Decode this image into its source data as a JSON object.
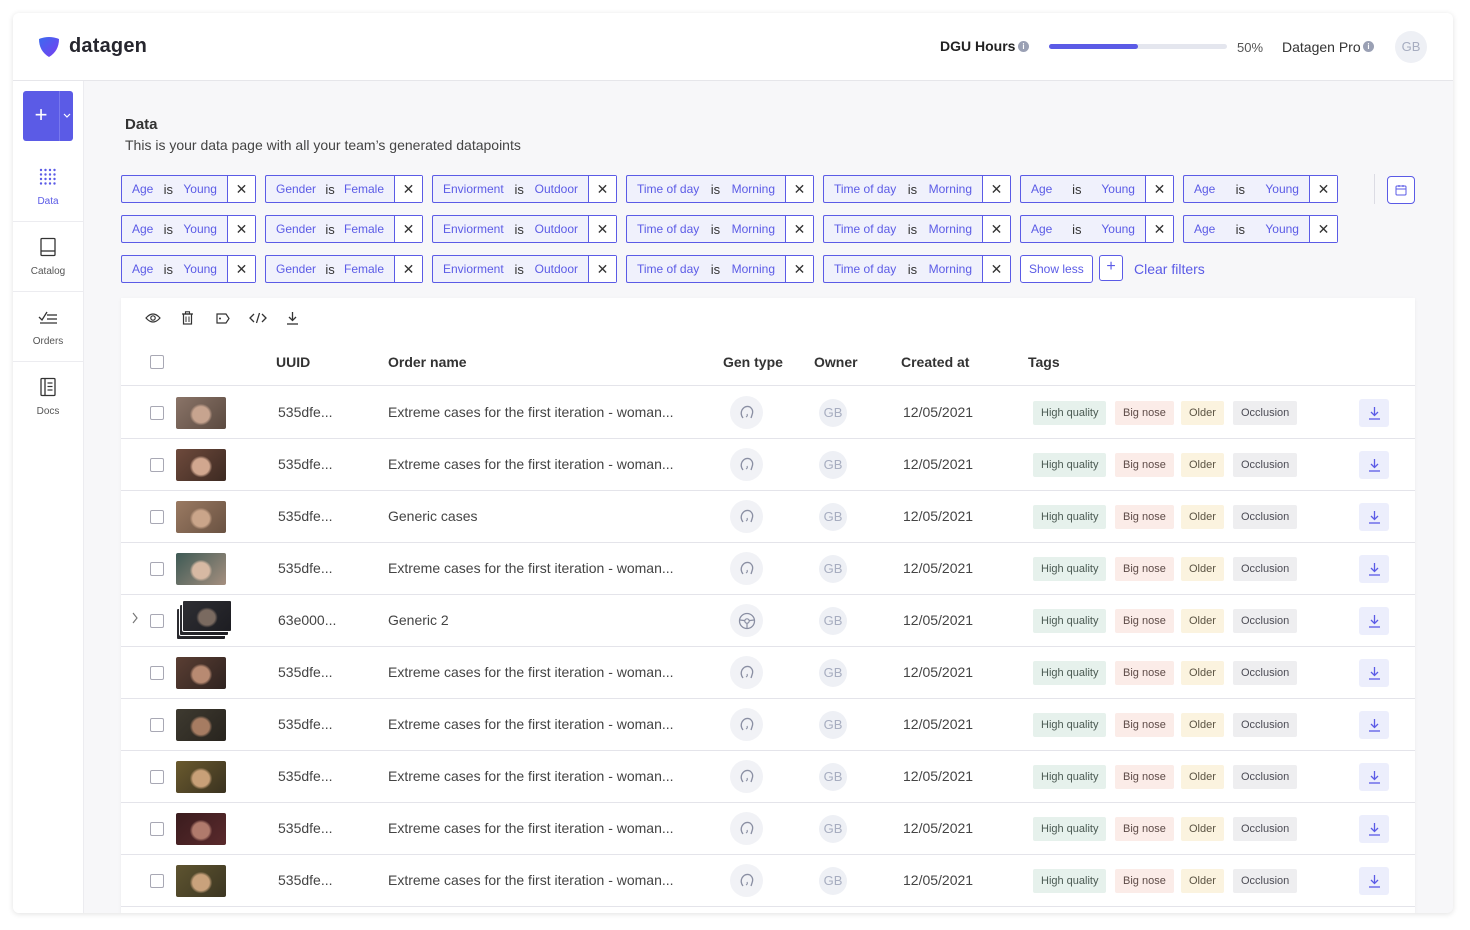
{
  "brand": {
    "name": "datagen",
    "accent": "#5b5be6"
  },
  "topbar": {
    "dgu_label": "DGU Hours",
    "progress_percent": 50,
    "progress_text": "50%",
    "plan_label": "Datagen Pro",
    "avatar": "GB",
    "info_glyph": "i"
  },
  "sidebar": {
    "add_glyph": "+",
    "items": [
      {
        "label": "Data",
        "icon": "grid-dots-icon",
        "active": true
      },
      {
        "label": "Catalog",
        "icon": "book-icon",
        "active": false
      },
      {
        "label": "Orders",
        "icon": "checklist-icon",
        "active": false
      },
      {
        "label": "Docs",
        "icon": "document-icon",
        "active": false
      }
    ]
  },
  "page": {
    "title": "Data",
    "subtitle": "This is your data page with all your team’s generated datapoints"
  },
  "filters": {
    "operator": "is",
    "remove_glyph": "✕",
    "rows": [
      [
        {
          "key": "Age",
          "value": "Young"
        },
        {
          "key": "Gender",
          "value": "Female"
        },
        {
          "key": "Enviorment",
          "value": "Outdoor"
        },
        {
          "key": "Time of day",
          "value": "Morning"
        },
        {
          "key": "Time of day",
          "value": "Morning"
        },
        {
          "key": "Age",
          "value": "Young"
        },
        {
          "key": "Age",
          "value": "Young"
        }
      ],
      [
        {
          "key": "Age",
          "value": "Young"
        },
        {
          "key": "Gender",
          "value": "Female"
        },
        {
          "key": "Enviorment",
          "value": "Outdoor"
        },
        {
          "key": "Time of day",
          "value": "Morning"
        },
        {
          "key": "Time of day",
          "value": "Morning"
        },
        {
          "key": "Age",
          "value": "Young"
        },
        {
          "key": "Age",
          "value": "Young"
        }
      ],
      [
        {
          "key": "Age",
          "value": "Young"
        },
        {
          "key": "Gender",
          "value": "Female"
        },
        {
          "key": "Enviorment",
          "value": "Outdoor"
        },
        {
          "key": "Time of day",
          "value": "Morning"
        },
        {
          "key": "Time of day",
          "value": "Morning"
        }
      ]
    ],
    "show_less_label": "Show less",
    "add_glyph": "+",
    "clear_label": "Clear filters"
  },
  "toolbar": {
    "icons": [
      "eye-icon",
      "trash-icon",
      "tag-icon",
      "code-icon",
      "download-icon"
    ]
  },
  "table": {
    "columns": {
      "uuid": "UUID",
      "order_name": "Order name",
      "gen_type": "Gen type",
      "owner": "Owner",
      "created_at": "Created at",
      "tags": "Tags"
    },
    "rows": [
      {
        "uuid": "535dfe...",
        "order_name": "Extreme cases for the first iteration - woman...",
        "gen_type": "face",
        "owner": "GB",
        "created_at": "12/05/2021",
        "tags": [
          "High quality",
          "Big nose",
          "Older",
          "Occlusion"
        ],
        "thumb": [
          "#8a7468",
          "#c7a48f",
          "#5b4a40"
        ],
        "expandable": false
      },
      {
        "uuid": "535dfe...",
        "order_name": "Extreme cases for the first iteration - woman...",
        "gen_type": "face",
        "owner": "GB",
        "created_at": "12/05/2021",
        "tags": [
          "High quality",
          "Big nose",
          "Older",
          "Occlusion"
        ],
        "thumb": [
          "#6e4a3c",
          "#d1a78f",
          "#3d2a22"
        ],
        "expandable": false
      },
      {
        "uuid": "535dfe...",
        "order_name": "Generic cases",
        "gen_type": "face",
        "owner": "GB",
        "created_at": "12/05/2021",
        "tags": [
          "High quality",
          "Big nose",
          "Older",
          "Occlusion"
        ],
        "thumb": [
          "#9a7a62",
          "#caa58a",
          "#6a5242"
        ],
        "expandable": false
      },
      {
        "uuid": "535dfe...",
        "order_name": "Extreme cases for the first iteration - woman...",
        "gen_type": "face",
        "owner": "GB",
        "created_at": "12/05/2021",
        "tags": [
          "High quality",
          "Big nose",
          "Older",
          "Occlusion"
        ],
        "thumb": [
          "#3e5a55",
          "#d7b9a3",
          "#a58f7f"
        ],
        "expandable": false
      },
      {
        "uuid": "63e000...",
        "order_name": "Generic 2",
        "gen_type": "steering-wheel",
        "owner": "GB",
        "created_at": "12/05/2021",
        "tags": [
          "High quality",
          "Big nose",
          "Older",
          "Occlusion"
        ],
        "thumb": [
          "#2e2e33",
          "#7a6a60",
          "#1d1d22"
        ],
        "expandable": true
      },
      {
        "uuid": "535dfe...",
        "order_name": "Extreme cases for the first iteration - woman...",
        "gen_type": "face",
        "owner": "GB",
        "created_at": "12/05/2021",
        "tags": [
          "High quality",
          "Big nose",
          "Older",
          "Occlusion"
        ],
        "thumb": [
          "#5a3e33",
          "#b88a72",
          "#2f2320"
        ],
        "expandable": false
      },
      {
        "uuid": "535dfe...",
        "order_name": "Extreme cases for the first iteration - woman...",
        "gen_type": "face",
        "owner": "GB",
        "created_at": "12/05/2021",
        "tags": [
          "High quality",
          "Big nose",
          "Older",
          "Occlusion"
        ],
        "thumb": [
          "#3e3a30",
          "#a67c62",
          "#28241e"
        ],
        "expandable": false
      },
      {
        "uuid": "535dfe...",
        "order_name": "Extreme cases for the first iteration - woman...",
        "gen_type": "face",
        "owner": "GB",
        "created_at": "12/05/2021",
        "tags": [
          "High quality",
          "Big nose",
          "Older",
          "Occlusion"
        ],
        "thumb": [
          "#6a5a2e",
          "#c8a078",
          "#3a3220"
        ],
        "expandable": false
      },
      {
        "uuid": "535dfe...",
        "order_name": "Extreme cases for the first iteration - woman...",
        "gen_type": "face",
        "owner": "GB",
        "created_at": "12/05/2021",
        "tags": [
          "High quality",
          "Big nose",
          "Older",
          "Occlusion"
        ],
        "thumb": [
          "#3a1c1e",
          "#b07a6c",
          "#5a2a2c"
        ],
        "expandable": false
      },
      {
        "uuid": "535dfe...",
        "order_name": "Extreme cases for the first iteration - woman...",
        "gen_type": "face",
        "owner": "GB",
        "created_at": "12/05/2021",
        "tags": [
          "High quality",
          "Big nose",
          "Older",
          "Occlusion"
        ],
        "thumb": [
          "#5e5430",
          "#c9a27c",
          "#3c3622"
        ],
        "expandable": false
      }
    ]
  }
}
